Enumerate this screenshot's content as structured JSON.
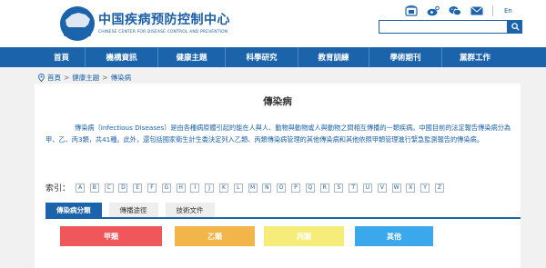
{
  "header": {
    "logo_text": "CDC",
    "site_name_cn": "中国疾病预防控制中心",
    "site_name_en": "CHINESE CENTER FOR DISEASE CONTROL AND PREVENTION",
    "lang_label": "En",
    "icons": [
      "phone-icon",
      "weibo-icon",
      "wechat-icon",
      "mail-icon"
    ],
    "search": {
      "value": "",
      "placeholder": ""
    }
  },
  "nav": {
    "items": [
      {
        "label": "首頁"
      },
      {
        "label": "機構資訊"
      },
      {
        "label": "健康主題"
      },
      {
        "label": "科學研究"
      },
      {
        "label": "教育訓練"
      },
      {
        "label": "學術期刊"
      },
      {
        "label": "黨群工作"
      }
    ]
  },
  "breadcrumb": {
    "items": [
      "首頁",
      "健康主題",
      "傳染病"
    ],
    "separator": ">"
  },
  "main": {
    "title": "傳染病",
    "description": "傳染病〔Infectious Diseases〕是由各種病原體引起的能在人與人、動物與動物或人與動物之間相互傳播的一類疾病。中國目前的法定報告傳染病分為甲、乙、丙3類，共41種。此外，還包括國家衛生計生委決定列入乙類、丙類傳染病管理的其他傳染病和其他依照甲類管理進行緊急監測報告的傳染病。",
    "index_label": "索引：",
    "letters": [
      "A",
      "B",
      "C",
      "D",
      "E",
      "F",
      "G",
      "H",
      "I",
      "J",
      "K",
      "L",
      "M",
      "N",
      "O",
      "P",
      "Q",
      "R",
      "S",
      "T",
      "U",
      "V",
      "W",
      "X",
      "Y",
      "Z"
    ],
    "tabs": [
      {
        "label": "傳染病分類",
        "active": true
      },
      {
        "label": "傳播途徑",
        "active": false
      },
      {
        "label": "技術文件",
        "active": false
      }
    ],
    "categories": [
      {
        "label": "甲類",
        "color": "#f0575a"
      },
      {
        "label": "乙類",
        "color": "#f2b54a"
      },
      {
        "label": "丙類",
        "color": "#f5ec79"
      },
      {
        "label": "其他",
        "color": "#3aa8ea"
      }
    ]
  },
  "colors": {
    "brand_blue": "#1b63ab",
    "page_bg": "#f1f1f1"
  }
}
